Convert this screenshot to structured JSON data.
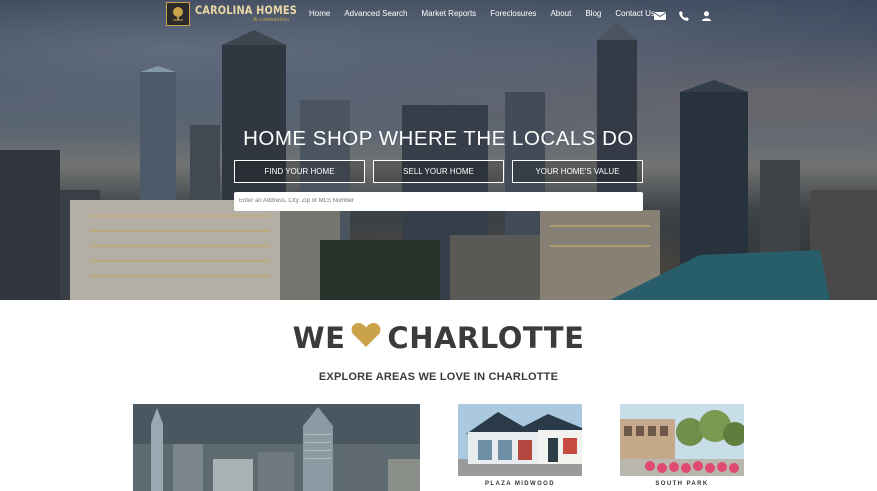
{
  "brand": {
    "name": "CAROLINA HOMES",
    "tagline": "& communities"
  },
  "nav": {
    "items": [
      "Home",
      "Advanced Search",
      "Market Reports",
      "Foreclosures",
      "About",
      "Blog",
      "Contact Us"
    ],
    "icons": [
      "envelope-icon",
      "phone-icon",
      "user-icon"
    ]
  },
  "hero": {
    "headline": "HOME SHOP WHERE THE LOCALS DO",
    "buttons": [
      "FIND YOUR HOME",
      "SELL YOUR HOME",
      "YOUR HOME'S VALUE"
    ],
    "search_placeholder": "Enter an Address, City, Zip or MLS Number"
  },
  "love": {
    "left": "WE",
    "right": "CHARLOTTE",
    "heart_color": "#c9a24a",
    "subtitle": "EXPLORE AREAS WE LOVE IN CHARLOTTE"
  },
  "areas": [
    {
      "label": ""
    },
    {
      "label": "PLAZA MIDWOOD"
    },
    {
      "label": "SOUTH PARK"
    }
  ],
  "colors": {
    "accent": "#c9a24a",
    "text": "#3b3b3b"
  }
}
